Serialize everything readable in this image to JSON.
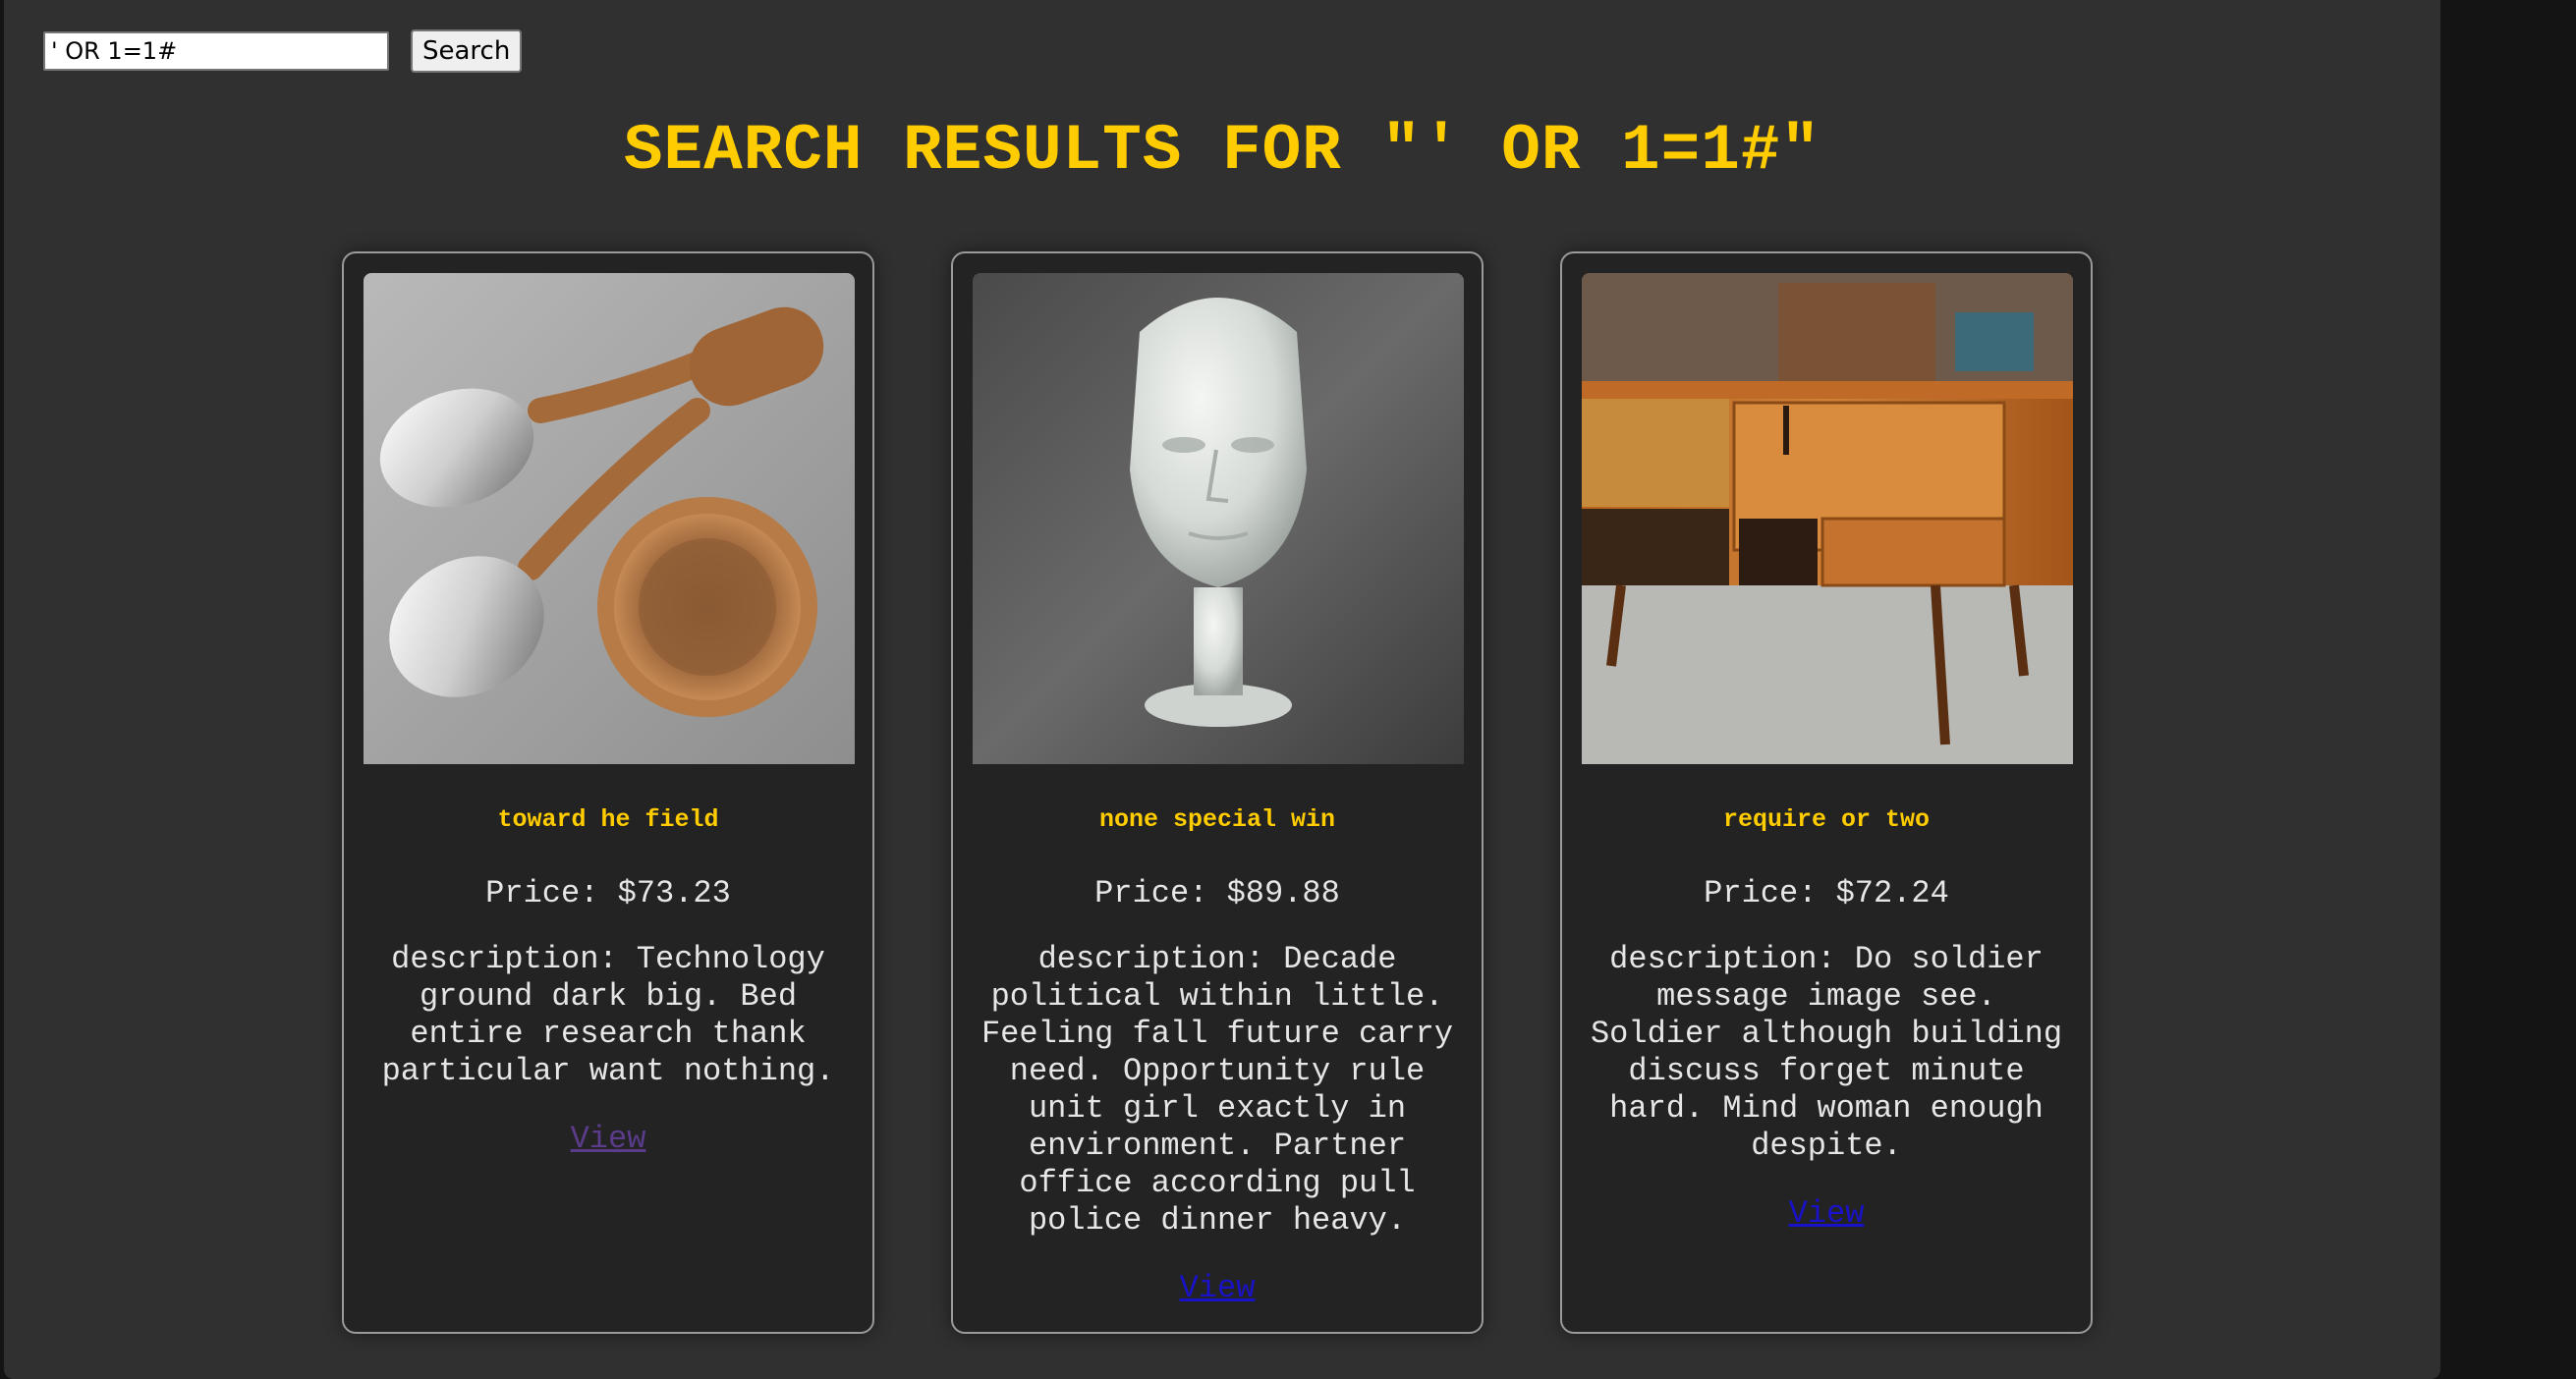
{
  "search": {
    "value": "' OR 1=1#",
    "button_label": "Search"
  },
  "page_title": "SEARCH RESULTS FOR \"' OR 1=1#\"",
  "products": [
    {
      "title": "toward he field",
      "price": "Price: $73.23",
      "description": "description: Technology ground dark big. Bed entire research thank particular want nothing.",
      "link_label": "View"
    },
    {
      "title": "none special win",
      "price": "Price: $89.88",
      "description": "description: Decade political within little. Feeling fall future carry need. Opportunity rule unit girl exactly in environment. Partner office according pull police dinner heavy.",
      "link_label": "View"
    },
    {
      "title": "require or two",
      "price": "Price: $72.24",
      "description": "description: Do soldier message image see. Soldier although building discuss forget minute hard. Mind woman enough despite.",
      "link_label": "View"
    }
  ]
}
